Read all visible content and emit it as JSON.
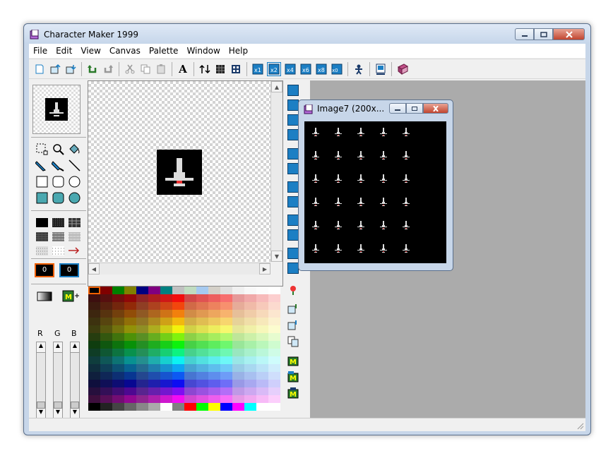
{
  "window": {
    "title": "Character Maker 1999",
    "minimize_icon": "minimize-icon",
    "maximize_icon": "maximize-icon",
    "close_icon": "close-icon"
  },
  "menu": [
    "File",
    "Edit",
    "View",
    "Canvas",
    "Palette",
    "Window",
    "Help"
  ],
  "toolbar": {
    "icons": [
      "new-icon",
      "open-icon",
      "save-icon",
      "undo-icon",
      "redo-icon",
      "cut-icon",
      "copy-icon",
      "paste-icon",
      "text-icon",
      "flip-icon",
      "grid-icon",
      "tile-icon",
      "zoom1-icon",
      "zoom2-icon",
      "zoom3-icon",
      "zoom4-icon",
      "zoom5-icon",
      "zoom6-icon",
      "character-icon",
      "preview-icon",
      "book-icon"
    ],
    "text_label": "A"
  },
  "slots": [
    "0",
    "0"
  ],
  "rgb": {
    "labels": [
      "R",
      "G",
      "B"
    ],
    "values": [
      "0",
      "0",
      "0"
    ]
  },
  "child_window": {
    "title": "Image7 (200x..."
  },
  "colors": {
    "accent": "#1c7fc4",
    "mdi_background": "#ababab",
    "titlebar": "#c7d6e9"
  }
}
